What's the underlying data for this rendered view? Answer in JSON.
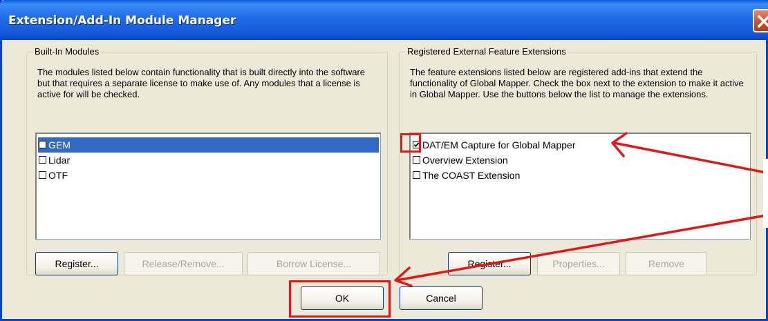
{
  "window": {
    "title": "Extension/Add-In Module Manager"
  },
  "builtin": {
    "group_label": "Built-In Modules",
    "description": "The modules listed below contain functionality that is built directly into the software but that requires a separate license to make use of. Any modules that a license is active for will be checked.",
    "items": [
      {
        "label": "GEM",
        "checked": false,
        "selected": true
      },
      {
        "label": "Lidar",
        "checked": false,
        "selected": false
      },
      {
        "label": "OTF",
        "checked": false,
        "selected": false
      }
    ],
    "buttons": {
      "register": "Register...",
      "release": "Release/Remove...",
      "borrow": "Borrow License..."
    }
  },
  "external": {
    "group_label": "Registered External Feature Extensions",
    "description": "The feature extensions listed below are registered add-ins that extend the functionality of Global Mapper.  Check the box next to the extension to make it active in Global Mapper. Use the buttons below the list to manage the extensions.",
    "items": [
      {
        "label": "DAT/EM Capture for Global Mapper",
        "checked": true
      },
      {
        "label": "Overview Extension",
        "checked": false
      },
      {
        "label": "The COAST Extension",
        "checked": false
      }
    ],
    "buttons": {
      "register": "Register...",
      "properties": "Properties...",
      "remove": "Remove"
    }
  },
  "footer": {
    "ok": "OK",
    "cancel": "Cancel"
  },
  "annotation_color": "#e01818"
}
